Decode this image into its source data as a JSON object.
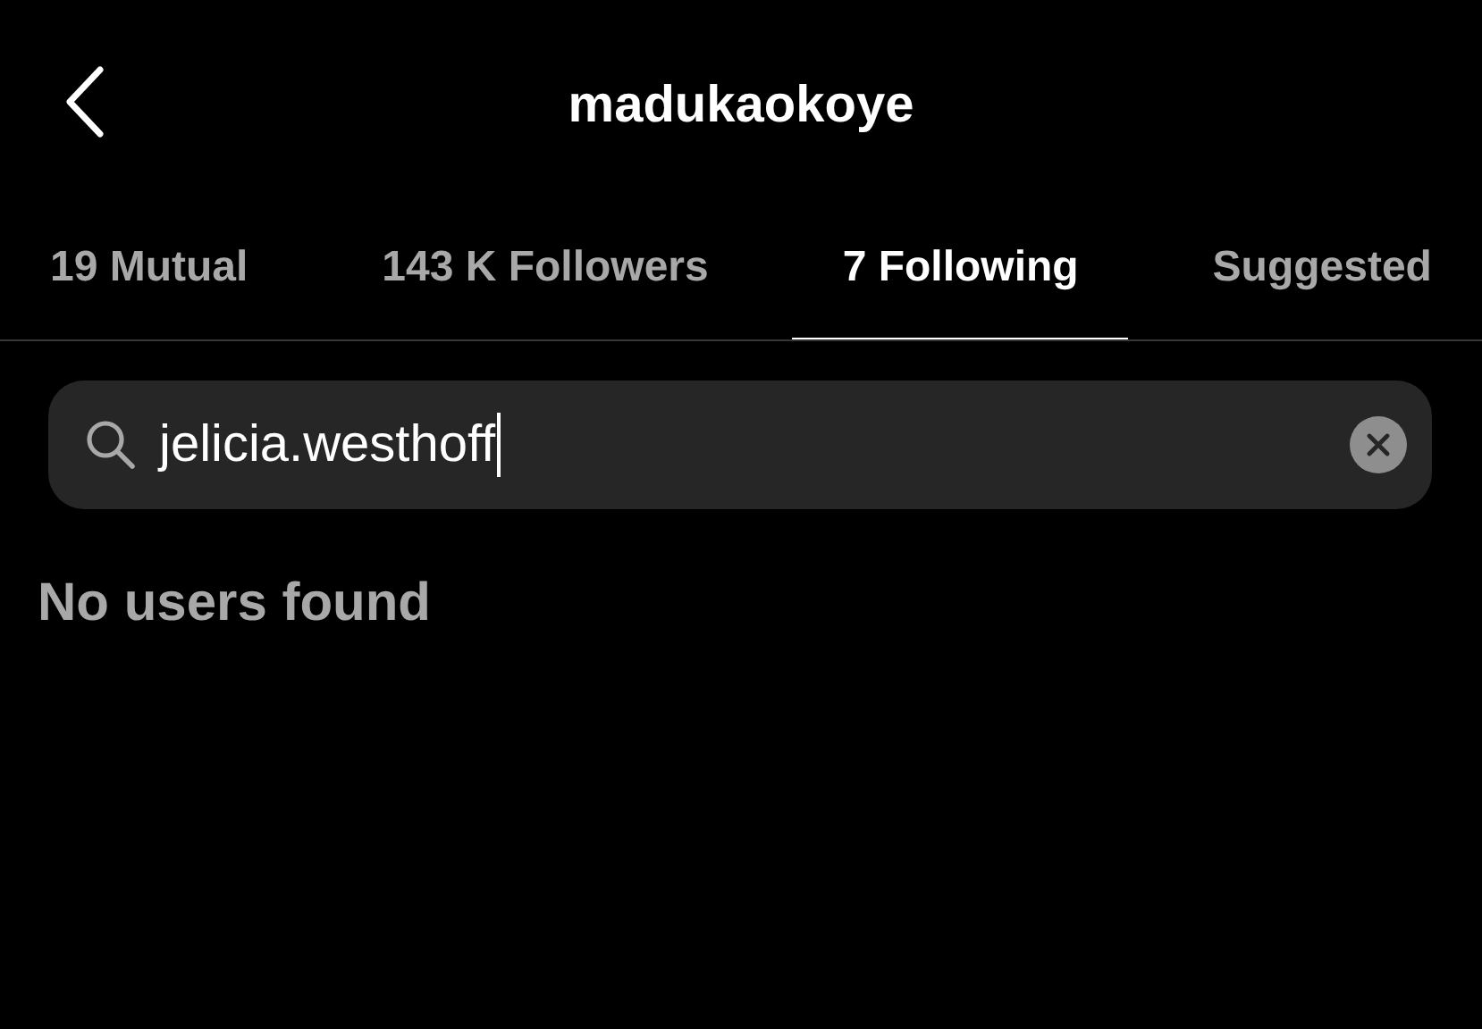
{
  "header": {
    "title": "madukaokoye"
  },
  "tabs": [
    {
      "label": "19 Mutual",
      "selected": false
    },
    {
      "label": "143 K Followers",
      "selected": false
    },
    {
      "label": "7 Following",
      "selected": true
    },
    {
      "label": "Suggested",
      "selected": false
    }
  ],
  "search": {
    "value": "jelicia.westhoff",
    "focused": true
  },
  "empty_message": "No users found"
}
